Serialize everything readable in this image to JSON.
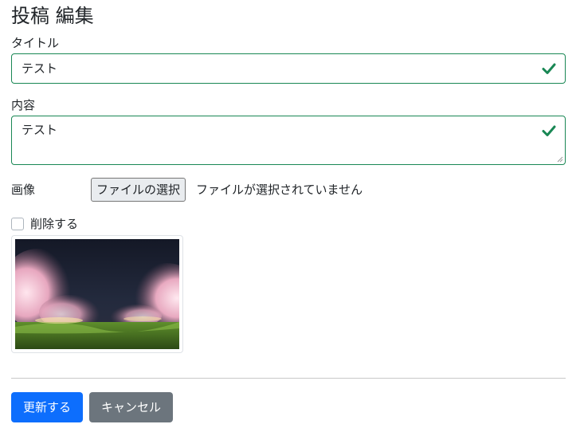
{
  "page": {
    "title": "投稿 編集"
  },
  "form": {
    "title_label": "タイトル",
    "title_value": "テスト",
    "content_label": "内容",
    "content_value": "テスト",
    "image_label": "画像",
    "file_button_label": "ファイルの選択",
    "file_status": "ファイルが選択されていません",
    "delete_label": "削除する",
    "delete_checked": false,
    "valid_color": "#198754"
  },
  "icons": {
    "valid": "check-icon",
    "thumbnail": "night-cherry-blossom-photo"
  },
  "actions": {
    "update_label": "更新する",
    "cancel_label": "キャンセル",
    "primary_color": "#0d6efd",
    "secondary_color": "#6c757d"
  }
}
